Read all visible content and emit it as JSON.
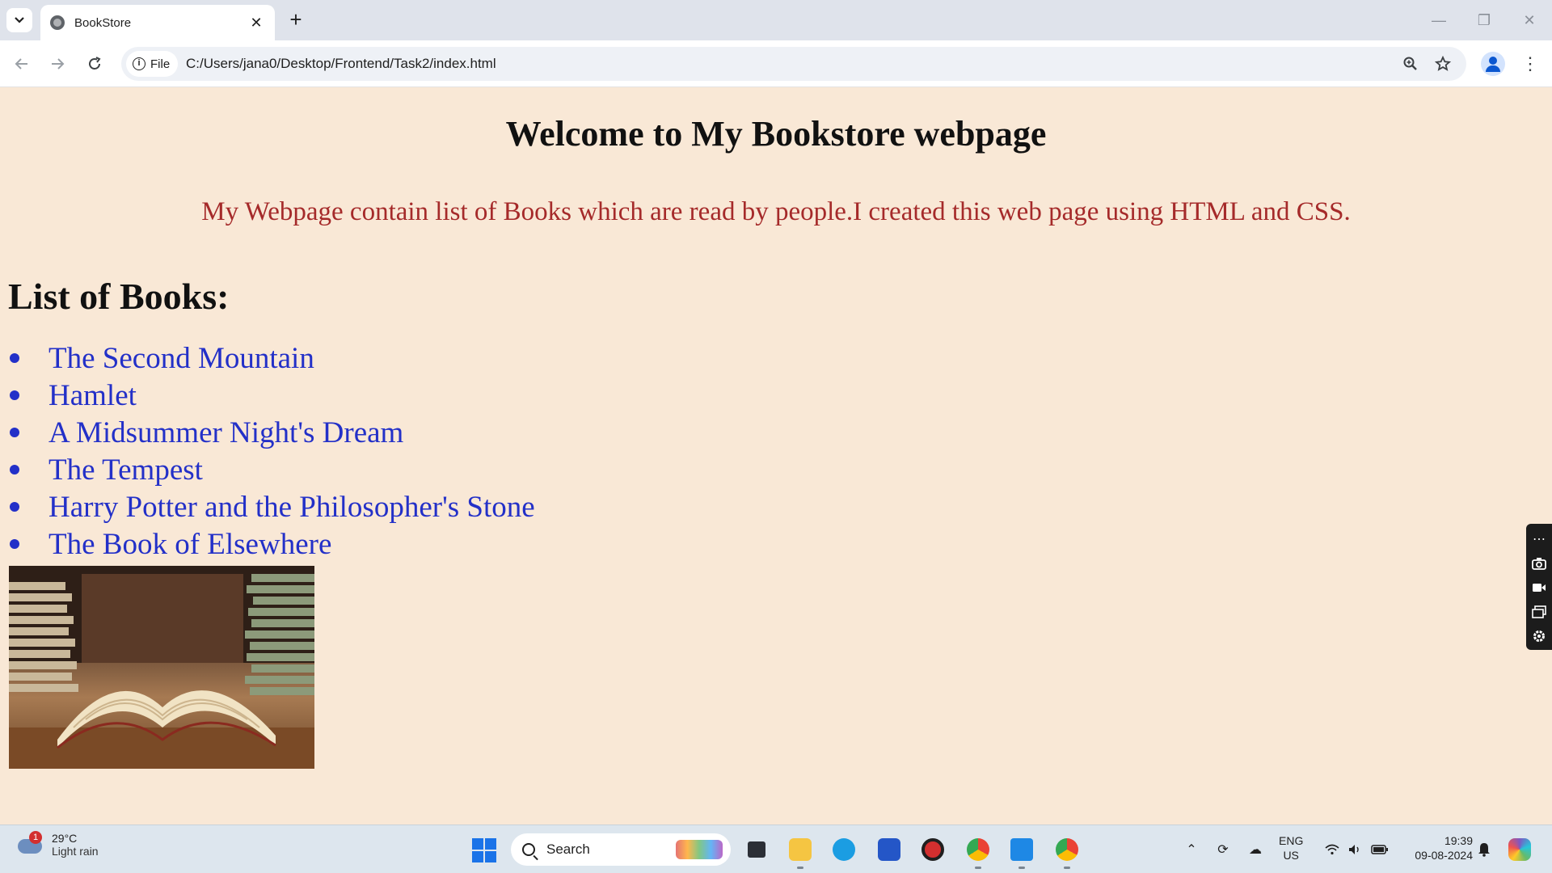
{
  "browser": {
    "tab_title": "BookStore",
    "site_chip_label": "File",
    "url": "C:/Users/jana0/Desktop/Frontend/Task2/index.html"
  },
  "page": {
    "title": "Welcome to My Bookstore webpage",
    "intro": "My Webpage contain list of Books which are read by people.I created this web page using HTML and CSS.",
    "list_heading": "List of Books:",
    "books": [
      "The Second Mountain",
      "Hamlet",
      "A Midsummer Night's Dream",
      "The Tempest",
      "Harry Potter and the Philosopher's Stone",
      "The Book of Elsewhere"
    ],
    "image_icon": "books-photo"
  },
  "colors": {
    "page_background": "#f9e8d6",
    "intro_text": "#a52a2a",
    "book_link": "#2330c8"
  },
  "taskbar": {
    "weather_badge": "1",
    "weather_temp": "29°C",
    "weather_condition": "Light rain",
    "search_label": "Search",
    "lang_top": "ENG",
    "lang_bottom": "US",
    "time": "19:39",
    "date": "09-08-2024"
  }
}
